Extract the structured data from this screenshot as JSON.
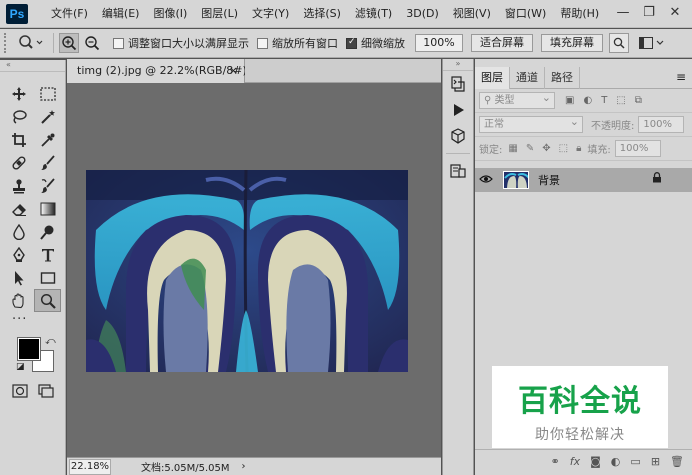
{
  "app": {
    "logo": "Ps"
  },
  "menu": [
    "文件(F)",
    "编辑(E)",
    "图像(I)",
    "图层(L)",
    "文字(Y)",
    "选择(S)",
    "滤镜(T)",
    "3D(D)",
    "视图(V)",
    "窗口(W)",
    "帮助(H)"
  ],
  "window_controls": {
    "minimize": "—",
    "restore": "❐",
    "close": "✕"
  },
  "options": {
    "resize_windows": "调整窗口大小以满屏显示",
    "zoom_all": "缩放所有窗口",
    "scrubby_zoom": "细微缩放",
    "zoom_value": "100%",
    "fit_screen": "适合屏幕",
    "fill_screen": "填充屏幕"
  },
  "document": {
    "tab_title": "timg (2).jpg @ 22.2%(RGB/8#) *",
    "close": "×",
    "status_zoom": "22.18%",
    "status_info": "文档:5.05M/5.05M",
    "status_arrow": "›"
  },
  "layers_panel": {
    "tabs": [
      "图层",
      "通道",
      "路径"
    ],
    "filter_kind": "类型",
    "blend_mode": "正常",
    "opacity_label": "不透明度:",
    "opacity_value": "100%",
    "lock_label": "锁定:",
    "fill_label": "填充:",
    "fill_value": "100%",
    "layer_name": "背景"
  },
  "watermark": {
    "title": "百科全说",
    "subtitle": "助你轻松解决"
  },
  "colors": {
    "foreground": "#000000",
    "background": "#ffffff",
    "active_layer": "#a9a9a9",
    "watermark_green": "#17a24a"
  }
}
